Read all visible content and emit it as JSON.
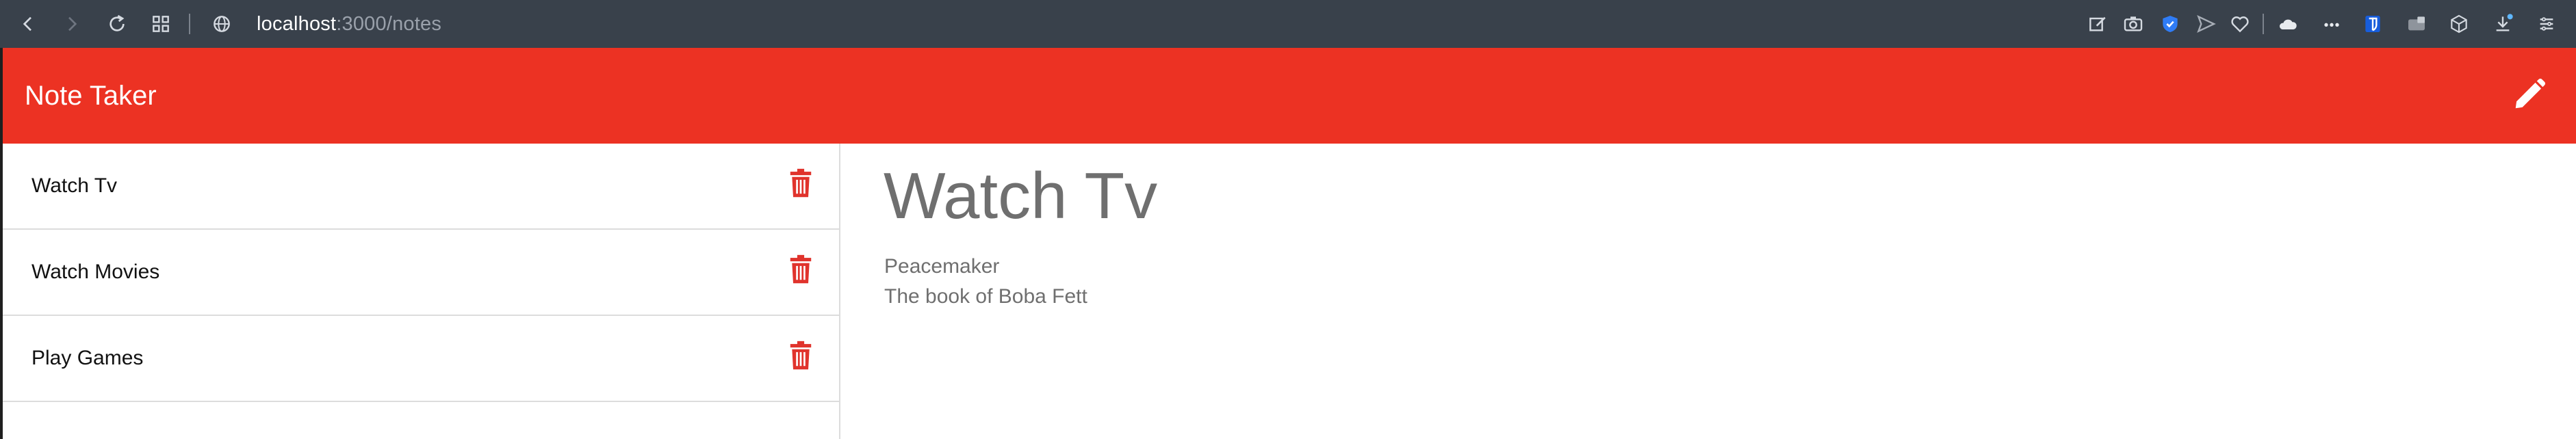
{
  "browser": {
    "url_host": "localhost",
    "url_path": ":3000/notes"
  },
  "header": {
    "title": "Note Taker"
  },
  "sidebar": {
    "items": [
      {
        "label": "Watch Tv"
      },
      {
        "label": "Watch Movies"
      },
      {
        "label": "Play Games"
      }
    ]
  },
  "note": {
    "title": "Watch Tv",
    "body_line1": "Peacemaker",
    "body_line2": "The book of Boba Fett"
  },
  "colors": {
    "header_bg": "#ec3223",
    "trash_icon": "#e0332c",
    "chrome_bg": "#39414b"
  },
  "icons": [
    "back-icon",
    "forward-icon",
    "reload-icon",
    "tabs-grid-icon",
    "globe-icon",
    "edit-page-icon",
    "screenshot-icon",
    "shield-icon",
    "send-icon",
    "heart-icon",
    "cloud-icon",
    "more-icon",
    "bitwarden-icon",
    "wallet-icon",
    "box-icon",
    "download-icon",
    "menu-icon",
    "pencil-icon",
    "trash-icon"
  ]
}
